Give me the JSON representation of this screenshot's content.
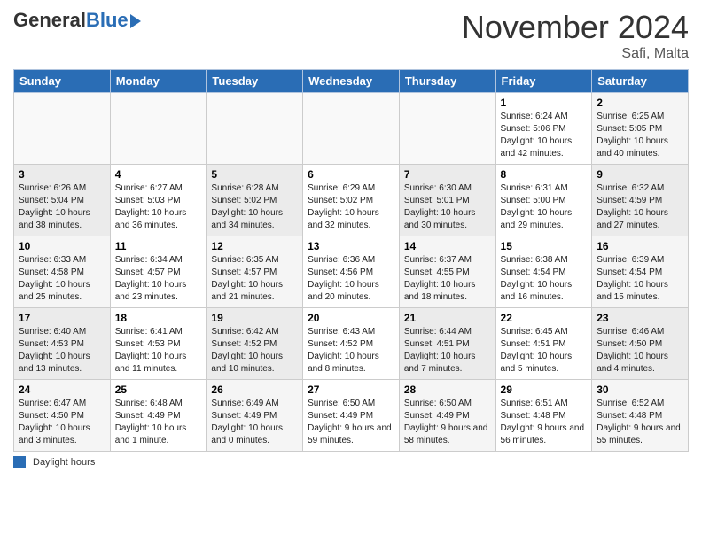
{
  "header": {
    "logo_general": "General",
    "logo_blue": "Blue",
    "month_title": "November 2024",
    "location": "Safi, Malta"
  },
  "days_of_week": [
    "Sunday",
    "Monday",
    "Tuesday",
    "Wednesday",
    "Thursday",
    "Friday",
    "Saturday"
  ],
  "weeks": [
    [
      {
        "day": "",
        "info": ""
      },
      {
        "day": "",
        "info": ""
      },
      {
        "day": "",
        "info": ""
      },
      {
        "day": "",
        "info": ""
      },
      {
        "day": "",
        "info": ""
      },
      {
        "day": "1",
        "info": "Sunrise: 6:24 AM\nSunset: 5:06 PM\nDaylight: 10 hours and 42 minutes."
      },
      {
        "day": "2",
        "info": "Sunrise: 6:25 AM\nSunset: 5:05 PM\nDaylight: 10 hours and 40 minutes."
      }
    ],
    [
      {
        "day": "3",
        "info": "Sunrise: 6:26 AM\nSunset: 5:04 PM\nDaylight: 10 hours and 38 minutes."
      },
      {
        "day": "4",
        "info": "Sunrise: 6:27 AM\nSunset: 5:03 PM\nDaylight: 10 hours and 36 minutes."
      },
      {
        "day": "5",
        "info": "Sunrise: 6:28 AM\nSunset: 5:02 PM\nDaylight: 10 hours and 34 minutes."
      },
      {
        "day": "6",
        "info": "Sunrise: 6:29 AM\nSunset: 5:02 PM\nDaylight: 10 hours and 32 minutes."
      },
      {
        "day": "7",
        "info": "Sunrise: 6:30 AM\nSunset: 5:01 PM\nDaylight: 10 hours and 30 minutes."
      },
      {
        "day": "8",
        "info": "Sunrise: 6:31 AM\nSunset: 5:00 PM\nDaylight: 10 hours and 29 minutes."
      },
      {
        "day": "9",
        "info": "Sunrise: 6:32 AM\nSunset: 4:59 PM\nDaylight: 10 hours and 27 minutes."
      }
    ],
    [
      {
        "day": "10",
        "info": "Sunrise: 6:33 AM\nSunset: 4:58 PM\nDaylight: 10 hours and 25 minutes."
      },
      {
        "day": "11",
        "info": "Sunrise: 6:34 AM\nSunset: 4:57 PM\nDaylight: 10 hours and 23 minutes."
      },
      {
        "day": "12",
        "info": "Sunrise: 6:35 AM\nSunset: 4:57 PM\nDaylight: 10 hours and 21 minutes."
      },
      {
        "day": "13",
        "info": "Sunrise: 6:36 AM\nSunset: 4:56 PM\nDaylight: 10 hours and 20 minutes."
      },
      {
        "day": "14",
        "info": "Sunrise: 6:37 AM\nSunset: 4:55 PM\nDaylight: 10 hours and 18 minutes."
      },
      {
        "day": "15",
        "info": "Sunrise: 6:38 AM\nSunset: 4:54 PM\nDaylight: 10 hours and 16 minutes."
      },
      {
        "day": "16",
        "info": "Sunrise: 6:39 AM\nSunset: 4:54 PM\nDaylight: 10 hours and 15 minutes."
      }
    ],
    [
      {
        "day": "17",
        "info": "Sunrise: 6:40 AM\nSunset: 4:53 PM\nDaylight: 10 hours and 13 minutes."
      },
      {
        "day": "18",
        "info": "Sunrise: 6:41 AM\nSunset: 4:53 PM\nDaylight: 10 hours and 11 minutes."
      },
      {
        "day": "19",
        "info": "Sunrise: 6:42 AM\nSunset: 4:52 PM\nDaylight: 10 hours and 10 minutes."
      },
      {
        "day": "20",
        "info": "Sunrise: 6:43 AM\nSunset: 4:52 PM\nDaylight: 10 hours and 8 minutes."
      },
      {
        "day": "21",
        "info": "Sunrise: 6:44 AM\nSunset: 4:51 PM\nDaylight: 10 hours and 7 minutes."
      },
      {
        "day": "22",
        "info": "Sunrise: 6:45 AM\nSunset: 4:51 PM\nDaylight: 10 hours and 5 minutes."
      },
      {
        "day": "23",
        "info": "Sunrise: 6:46 AM\nSunset: 4:50 PM\nDaylight: 10 hours and 4 minutes."
      }
    ],
    [
      {
        "day": "24",
        "info": "Sunrise: 6:47 AM\nSunset: 4:50 PM\nDaylight: 10 hours and 3 minutes."
      },
      {
        "day": "25",
        "info": "Sunrise: 6:48 AM\nSunset: 4:49 PM\nDaylight: 10 hours and 1 minute."
      },
      {
        "day": "26",
        "info": "Sunrise: 6:49 AM\nSunset: 4:49 PM\nDaylight: 10 hours and 0 minutes."
      },
      {
        "day": "27",
        "info": "Sunrise: 6:50 AM\nSunset: 4:49 PM\nDaylight: 9 hours and 59 minutes."
      },
      {
        "day": "28",
        "info": "Sunrise: 6:50 AM\nSunset: 4:49 PM\nDaylight: 9 hours and 58 minutes."
      },
      {
        "day": "29",
        "info": "Sunrise: 6:51 AM\nSunset: 4:48 PM\nDaylight: 9 hours and 56 minutes."
      },
      {
        "day": "30",
        "info": "Sunrise: 6:52 AM\nSunset: 4:48 PM\nDaylight: 9 hours and 55 minutes."
      }
    ]
  ],
  "footer": {
    "legend_label": "Daylight hours"
  }
}
